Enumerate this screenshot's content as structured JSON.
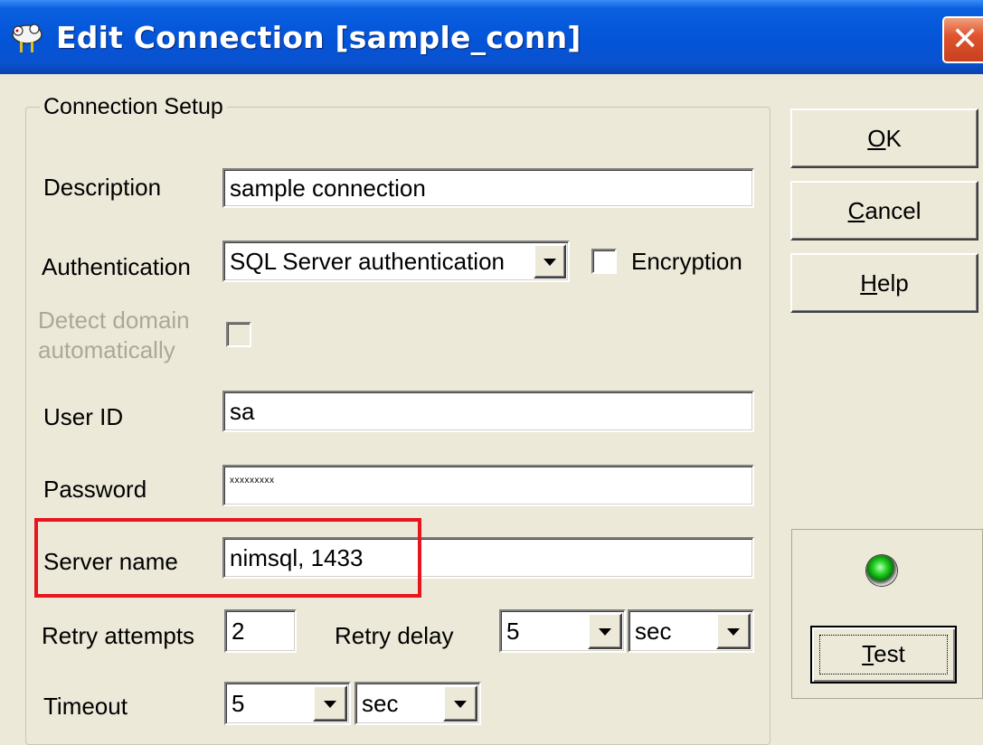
{
  "window": {
    "title": "Edit Connection [sample_conn]",
    "close_glyph": "✕",
    "app_icon": "sheep-app-icon"
  },
  "group": {
    "label": "Connection Setup"
  },
  "fields": {
    "description": {
      "label": "Description",
      "value": "sample connection"
    },
    "authentication": {
      "label": "Authentication",
      "value": "SQL Server authentication"
    },
    "encryption": {
      "label": "Encryption",
      "checked": false
    },
    "detect_domain": {
      "label": "Detect domain automatically",
      "checked": false,
      "enabled": false
    },
    "user_id": {
      "label": "User ID",
      "value": "sa"
    },
    "password": {
      "label": "Password",
      "value": "xxxxxxxxx"
    },
    "server_name": {
      "label": "Server name",
      "value": "nimsql, 1433"
    },
    "retry_attempts": {
      "label": "Retry attempts",
      "value": "2"
    },
    "retry_delay": {
      "label": "Retry delay",
      "value": "5",
      "unit": "sec"
    },
    "timeout": {
      "label": "Timeout",
      "value": "5",
      "unit": "sec"
    }
  },
  "buttons": {
    "ok": {
      "mnemonic": "O",
      "rest": "K"
    },
    "cancel": {
      "mnemonic": "C",
      "rest": "ancel"
    },
    "help": {
      "mnemonic": "H",
      "rest": "elp"
    },
    "test": {
      "mnemonic": "T",
      "rest": "est"
    }
  },
  "status": {
    "indicator": "green",
    "icon": "status-led-icon"
  },
  "colors": {
    "titlebar": "#0454d8",
    "face": "#ece9d8",
    "highlight_box": "#e8141e",
    "led": "#22d022"
  }
}
